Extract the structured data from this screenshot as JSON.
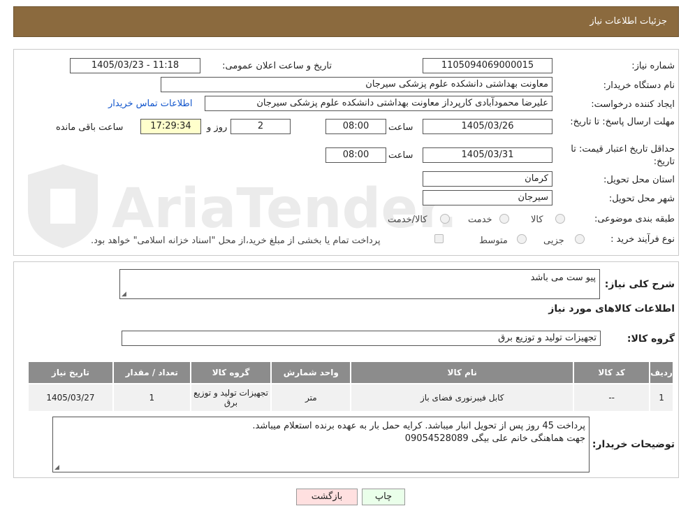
{
  "header": {
    "title": "جزئیات اطلاعات نیاز"
  },
  "fields": {
    "need_number_label": "شماره نیاز:",
    "need_number": "1105094069000015",
    "announce_label": "تاریخ و ساعت اعلان عمومی:",
    "announce_value": "1405/03/23 - 11:18",
    "buyer_label": "نام دستگاه خریدار:",
    "buyer_value": "معاونت بهداشتی دانشکده علوم پزشکی سیرجان",
    "creator_label": "ایجاد کننده درخواست:",
    "creator_value": "علیرضا  محمودآبادی کارپرداز معاونت بهداشتی دانشکده علوم پزشکی سیرجان",
    "contact_link": "اطلاعات تماس خریدار",
    "deadline_label": "مهلت ارسال پاسخ: تا تاریخ:",
    "deadline_date": "1405/03/26",
    "time_label": "ساعت",
    "deadline_time": "08:00",
    "days_value": "2",
    "days_label": "روز و",
    "remaining_time": "17:29:34",
    "remaining_label": "ساعت باقی مانده",
    "price_validity_label": "حداقل تاریخ اعتبار قیمت: تا تاریخ:",
    "price_validity_date": "1405/03/31",
    "price_validity_time": "08:00",
    "province_label": "استان محل تحویل:",
    "province_value": "کرمان",
    "city_label": "شهر محل تحویل:",
    "city_value": "سیرجان",
    "category_label": "طبقه بندی موضوعی:",
    "category_options": [
      "کالا",
      "خدمت",
      "کالا/خدمت"
    ],
    "process_label": "نوع فرآیند خرید :",
    "process_options": [
      "جزیی",
      "متوسط"
    ],
    "payment_note": "پرداخت تمام یا بخشی از مبلغ خرید،از محل \"اسناد خزانه اسلامی\" خواهد بود."
  },
  "description": {
    "label": "شرح کلی نیاز:",
    "value": "پیو ست می باشد"
  },
  "goods_section": {
    "title": "اطلاعات کالاهای مورد نیاز",
    "group_label": "گروه کالا:",
    "group_value": "تجهیزات تولید و توزیع برق"
  },
  "table": {
    "headers": [
      "ردیف",
      "کد کالا",
      "نام کالا",
      "واحد شمارش",
      "گروه کالا",
      "تعداد / مقدار",
      "تاریخ نیاز"
    ],
    "rows": [
      [
        "1",
        "--",
        "کابل فیبرنوری فضای باز",
        "متر",
        "تجهیزات تولید و توزیع برق",
        "1",
        "1405/03/27"
      ]
    ]
  },
  "buyer_notes": {
    "label": "توضیحات خریدار:",
    "line1": "پرداخت 45 روز پس از تحویل انبار میباشد. کرایه حمل بار به عهده برنده استعلام میباشد.",
    "line2": "جهت هماهنگی خانم علی بیگی 09054528089"
  },
  "buttons": {
    "print": "چاپ",
    "back": "بازگشت"
  },
  "watermark_text": "AriaTender.neT",
  "colors": {
    "header_bg": "#8B6A3E",
    "table_header": "#8c8c8c",
    "remaining_bg": "#ffffcc",
    "back_btn": "#ffe0e0",
    "print_btn": "#eaffea"
  }
}
